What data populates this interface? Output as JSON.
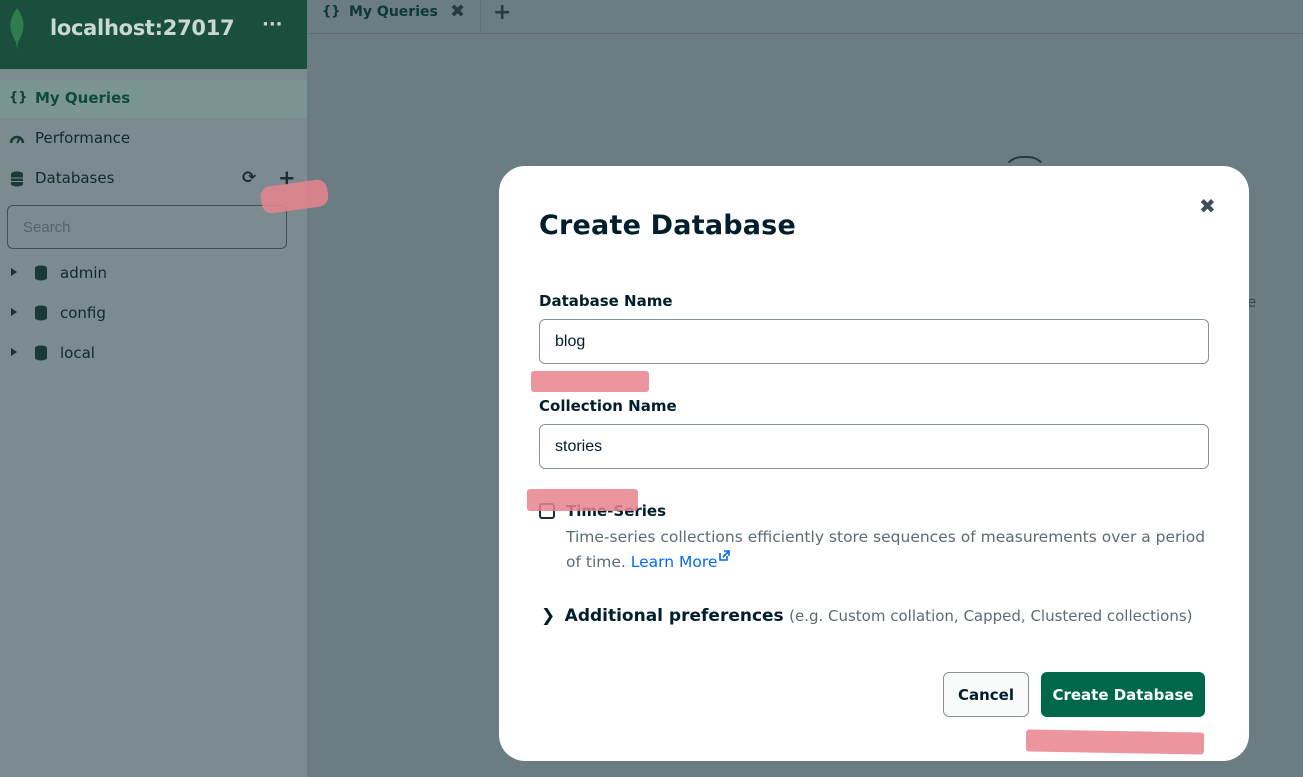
{
  "sidebar": {
    "host": "localhost:27017",
    "menu_glyph": "···",
    "nav": [
      {
        "label": "My Queries",
        "icon": "curly-braces-icon",
        "glyph": "{}"
      },
      {
        "label": "Performance",
        "icon": "gauge-icon"
      },
      {
        "label": "Databases",
        "icon": "database-icon"
      }
    ],
    "refresh_glyph": "⟳",
    "add_glyph": "+",
    "search_placeholder": "Search",
    "databases": [
      "admin",
      "config",
      "local"
    ]
  },
  "tabs": [
    {
      "label": "My Queries",
      "glyph": "{}",
      "close_glyph": "✖"
    }
  ],
  "add_tab_glyph": "+",
  "background_fragment": "e",
  "modal": {
    "title": "Create Database",
    "close_glyph": "✖",
    "database_name_label": "Database Name",
    "database_name_value": "blog",
    "collection_name_label": "Collection Name",
    "collection_name_value": "stories",
    "time_series": {
      "label": "Time-Series",
      "checked": false,
      "description": "Time-series collections efficiently store sequences of measurements over a period of time.",
      "learn_more": "Learn More"
    },
    "additional_prefs": {
      "chevron": "❯",
      "title": "Additional preferences",
      "hint": "(e.g. Custom collation, Capped, Clustered collections)"
    },
    "cancel_label": "Cancel",
    "create_label": "Create Database"
  },
  "colors": {
    "brand_green": "#00684a",
    "sidebar_header": "#1a4f3e",
    "link": "#016bf8",
    "highlight": "#e8848e"
  }
}
